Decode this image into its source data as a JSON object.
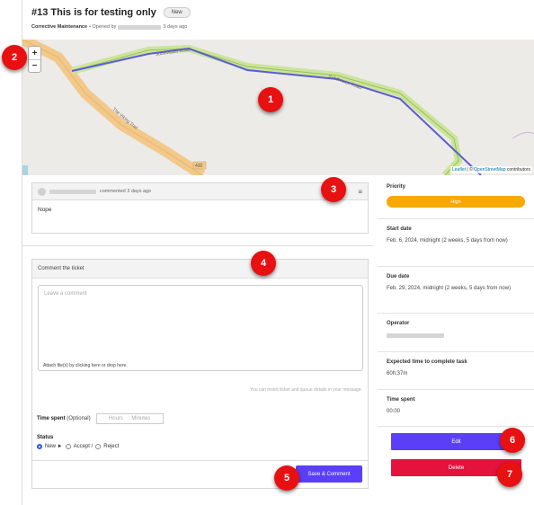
{
  "ticket": {
    "title": "#13 This is for testing only",
    "status_badge": "New",
    "category": "Corrective Maintenance",
    "opened_by_prefix": "• Opened by",
    "opened_ago": "3 days ago"
  },
  "map": {
    "zoom_in": "+",
    "zoom_out": "−",
    "roads": [
      "Subdivision Road",
      "Subdivision Road",
      "The Viking Trail",
      "430"
    ],
    "attribution_leaflet": "Leaflet",
    "attribution_sep": " | © ",
    "attribution_osm": "OpenStreetMap",
    "attribution_suffix": " contributors"
  },
  "comment": {
    "action": "commented 3 days ago",
    "text": "Nope",
    "menu_icon": "hamburger-icon"
  },
  "form": {
    "header": "Comment the ticket",
    "placeholder": "Leave a comment",
    "attach_text": "Attach file(s) by clicking here or drop here.",
    "hint": "You can insert ticket and queue details in your message.",
    "time_spent_label": "Time spent",
    "time_spent_optional": "(Optional)",
    "hours_placeholder": "Hours",
    "minutes_placeholder": ": Minutes",
    "status_label": "Status",
    "status_options": {
      "new": "New ►",
      "accept": "Accept /",
      "reject": "Reject"
    },
    "save_button": "Save & Comment"
  },
  "sidebar": {
    "priority_label": "Priority",
    "priority_value": "High",
    "start_label": "Start date",
    "start_value": "Feb. 6, 2024, midnight (2 weeks, 5 days from now)",
    "due_label": "Due date",
    "due_value": "Feb. 29, 2024, midnight (2 weeks, 5 days from now)",
    "operator_label": "Operator",
    "expected_label": "Expected time to complete task",
    "expected_value": "60h:37m",
    "spent_label": "Time spent",
    "spent_value": "00:00",
    "edit_button": "Edit",
    "delete_button": "Delete"
  },
  "markers": [
    "1",
    "2",
    "3",
    "4",
    "5",
    "6",
    "7"
  ],
  "colors": {
    "primary": "#5b3ff8",
    "danger": "#e5123d",
    "priority_high": "#f8a800",
    "marker": "#e81010"
  }
}
